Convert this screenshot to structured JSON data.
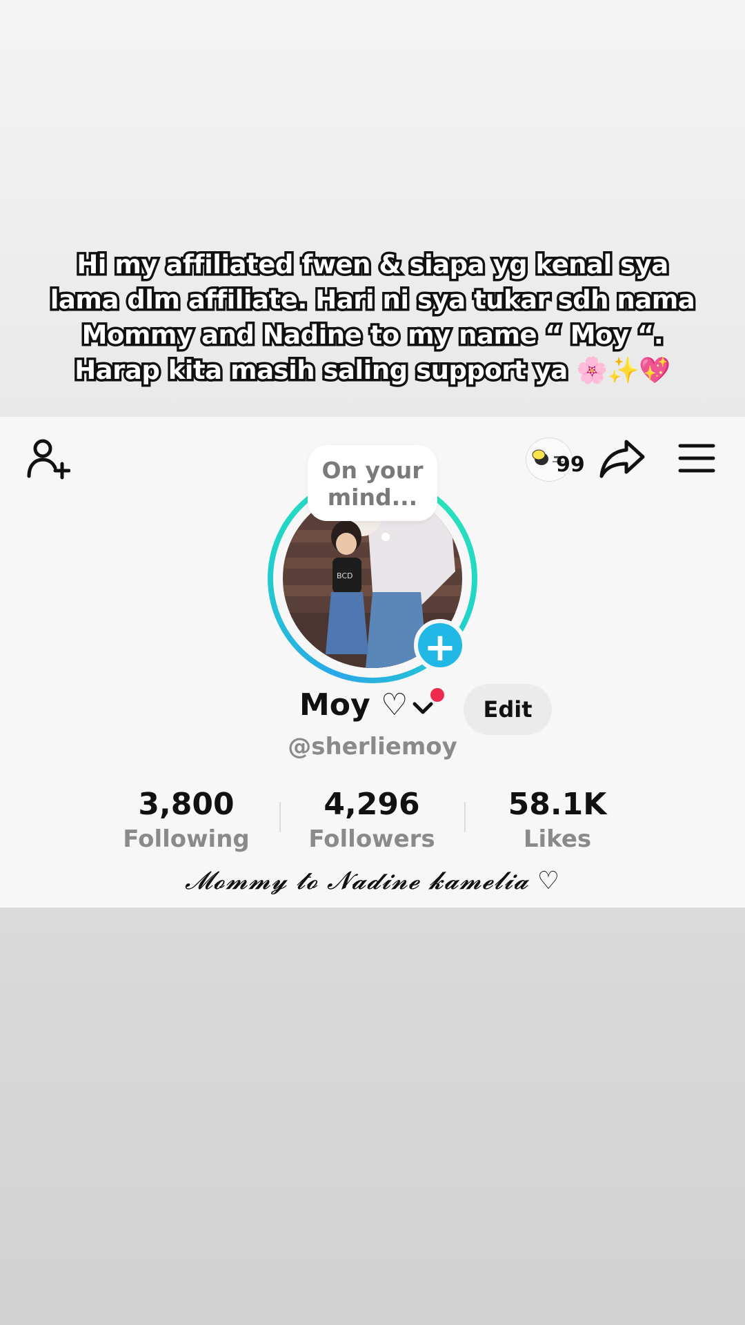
{
  "caption": {
    "lines": [
      "Hi my affiliated fwen & siapa yg kenal sya",
      "lama dlm affiliate. Hari ni sya tukar sdh nama",
      "Mommy and Nadine to my name “ Moy “.",
      "Harap kita masih saling support ya 🌸✨💖"
    ]
  },
  "header": {
    "add_friend_icon": "add-user-icon",
    "sticker_count": "99",
    "share_icon": "share-arrow-icon",
    "menu_icon": "hamburger-menu-icon"
  },
  "avatar": {
    "mind_bubble": "On your mind...",
    "plus_icon": "plus-icon"
  },
  "profile": {
    "display_name": "Moy ♡",
    "edit_label": "Edit",
    "username": "@sherliemoy",
    "bio": "𝓜𝓸𝓶𝓶𝔂 𝓽𝓸 𝓝𝓪𝓭𝓲𝓷𝓮 𝓴𝓪𝓶𝓮𝓵𝓲𝓪 ♡"
  },
  "stats": [
    {
      "value": "3,800",
      "label": "Following"
    },
    {
      "value": "4,296",
      "label": "Followers"
    },
    {
      "value": "58.1K",
      "label": "Likes"
    }
  ],
  "colors": {
    "accent_blue": "#22b8e6",
    "ring_teal": "#2ce5b6",
    "notification_red": "#ee2b4f"
  }
}
